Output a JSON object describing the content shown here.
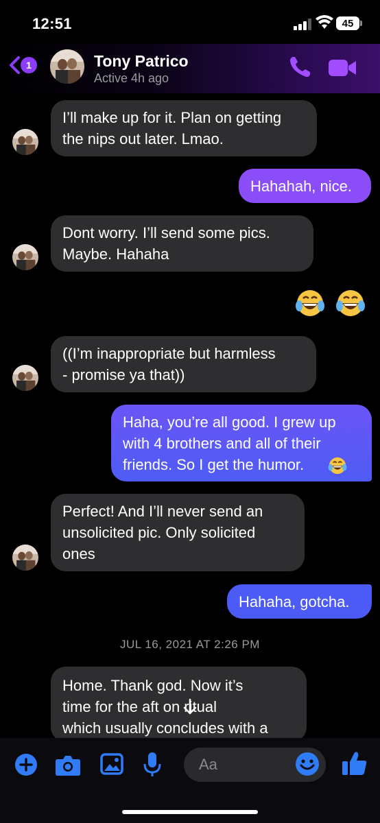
{
  "status_bar": {
    "time": "12:51",
    "battery": "45"
  },
  "header": {
    "unread_badge": "1",
    "contact_name": "Tony Patrico",
    "contact_status": "Active 4h ago"
  },
  "messages": [
    {
      "from": "them",
      "text": "I’ll make up for it. Plan on getting\nthe nips out later.  Lmao."
    },
    {
      "from": "me",
      "text": "Hahahah, nice."
    },
    {
      "from": "them",
      "text": "Dont worry. I’ll send some pics.\nMaybe.  Hahaha"
    },
    {
      "from": "me",
      "emoji": [
        "face-with-tears-of-joy",
        "face-with-tears-of-joy"
      ]
    },
    {
      "from": "them",
      "text": "((I’m inappropriate but harmless\n- promise ya that))"
    },
    {
      "from": "me",
      "text": "Haha, you’re all good. I grew up\nwith 4 brothers and all of their\nfriends. So I get the humor."
    },
    {
      "from": "them",
      "text": "Perfect!  And I’ll never send an\nunsolicited pic.  Only solicited\nones"
    },
    {
      "from": "me",
      "text": "Hahaha, gotcha."
    },
    {
      "from": "them",
      "text": "Home.  Thank god.  Now it’s\ntime for the aft      on ritual\nwhich usually concludes with a"
    }
  ],
  "date_separator": "JUL 16, 2021 AT 2:26 PM",
  "composer": {
    "placeholder": "Aa"
  },
  "colors": {
    "accent": "#8c3dfa",
    "outgoing_purple": "#8b4df7",
    "outgoing_blue": "#4c5bf5",
    "incoming": "#2e2e30",
    "composer_icons": "#2f7cf6"
  }
}
